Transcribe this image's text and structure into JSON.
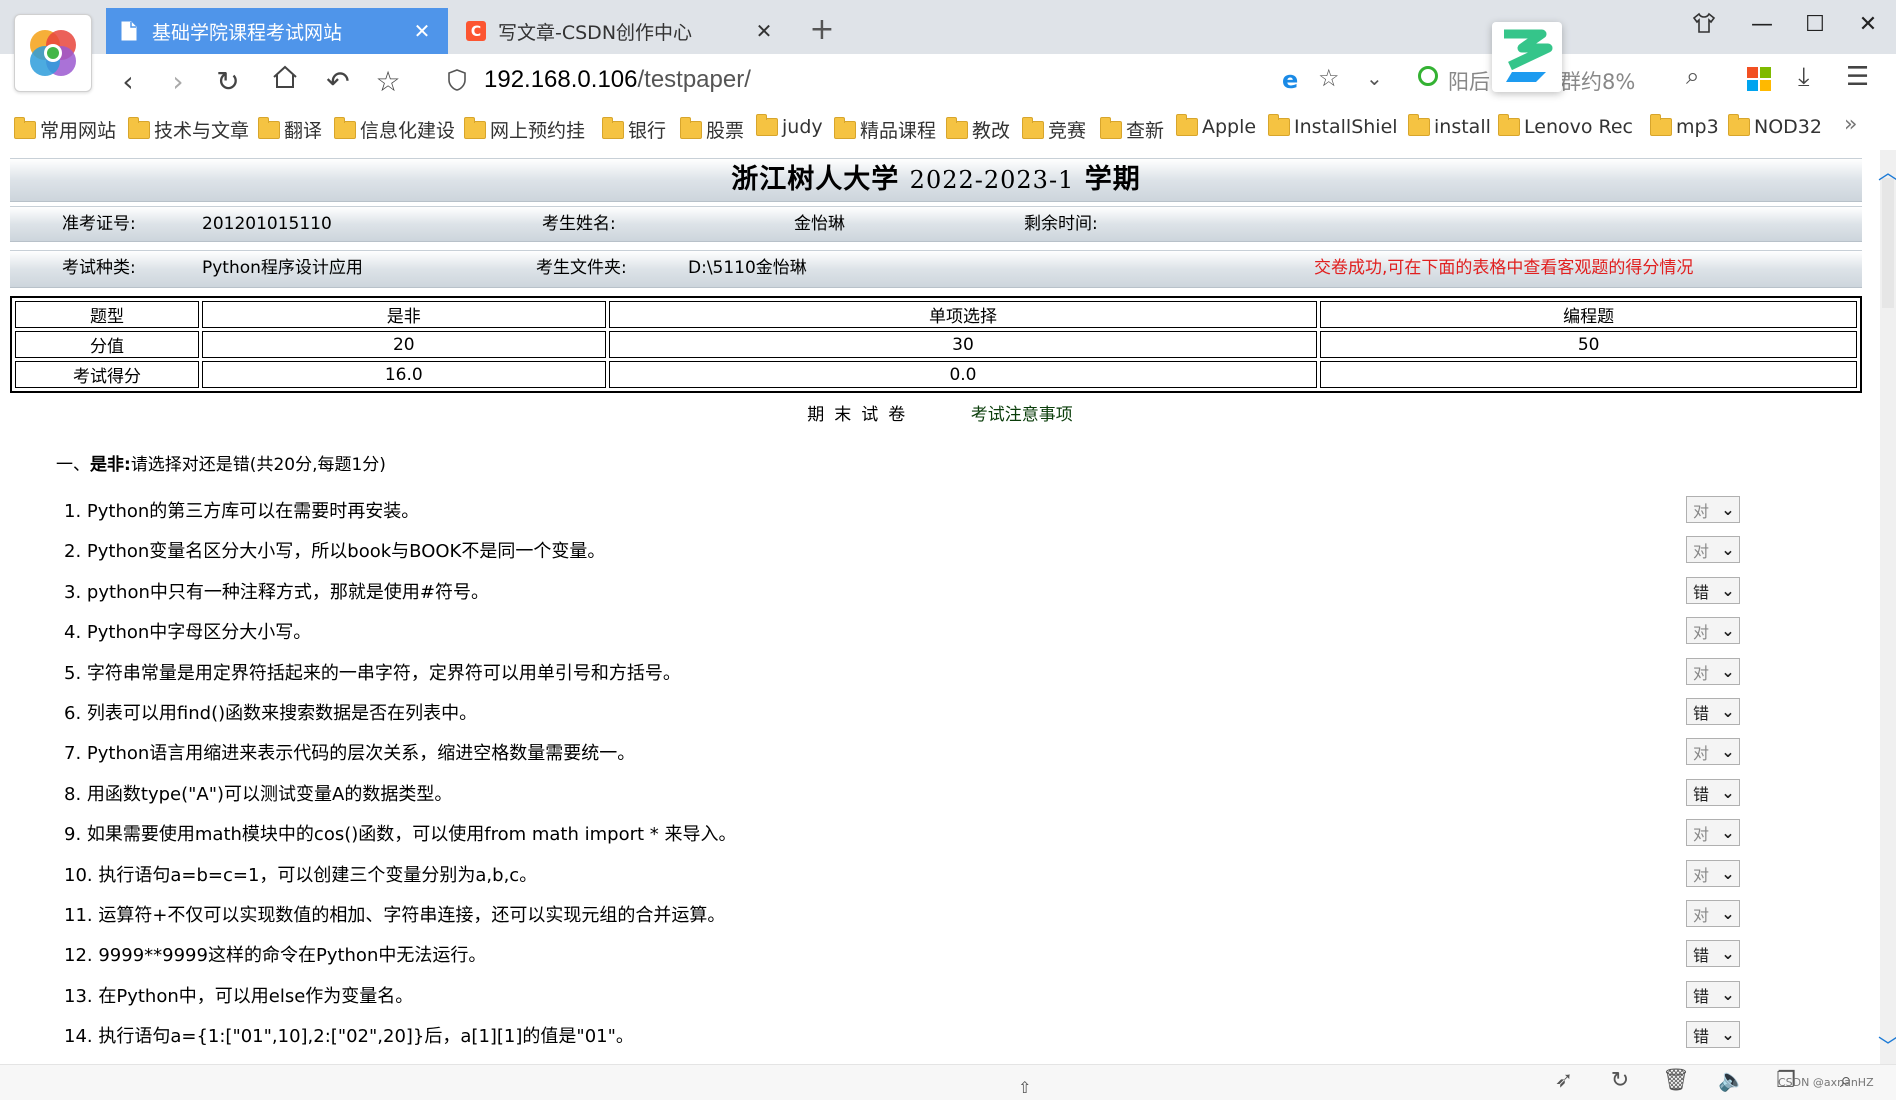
{
  "browser": {
    "tabs": [
      {
        "label": "基础学院课程考试网站",
        "active": true,
        "icon": "page-icon"
      },
      {
        "label": "写文章-CSDN创作中心",
        "active": false,
        "icon": "csdn-icon"
      }
    ],
    "new_tab_glyph": "+",
    "url_host": "192.168.0.106",
    "url_path": "/testpaper/",
    "search_text_left": "阳后",
    "search_text_right": "群约8%",
    "window_controls": [
      "shirt-icon",
      "minimize-icon",
      "maximize-icon",
      "close-icon"
    ],
    "bookmarks": [
      "常用网站",
      "技术与文章",
      "翻译",
      "信息化建设",
      "网上预约挂",
      "银行",
      "股票",
      "judy",
      "精品课程",
      "教改",
      "竞赛",
      "查新",
      "Apple",
      "InstallShiel",
      "install",
      "Lenovo Rec",
      "mp3",
      "NOD32"
    ],
    "bookmarks_more": "»"
  },
  "exam": {
    "title_school": "浙江树人大学",
    "title_term": "2022-2023-1",
    "title_suffix": "学期",
    "ticket_label": "准考证号:",
    "ticket_value": "201201015110",
    "name_label": "考生姓名:",
    "name_value": "金怡琳",
    "time_label": "剩余时间:",
    "type_label": "考试种类:",
    "type_value": "Python程序设计应用",
    "folder_label": "考生文件夹:",
    "folder_value": "D:\\5110金怡琳",
    "status_message": "交卷成功,可在下面的表格中查看客观题的得分情况",
    "status_color": "#e02020"
  },
  "score_table": {
    "row_labels": [
      "题型",
      "分值",
      "考试得分"
    ],
    "columns": [
      "是非",
      "单项选择",
      "编程题"
    ],
    "points": [
      "20",
      "30",
      "50"
    ],
    "scores": [
      "16.0",
      "0.0",
      ""
    ]
  },
  "links": {
    "paper": "期末试卷",
    "notice": "考试注意事项"
  },
  "section": {
    "number": "一、",
    "name": "是非:",
    "desc": "请选择对还是错(共20分,每题1分)"
  },
  "questions": [
    {
      "text": "1. Python的第三方库可以在需要时再安装。",
      "answer": "对"
    },
    {
      "text": "2. Python变量名区分大小写，所以book与BOOK不是同一个变量。",
      "answer": "对"
    },
    {
      "text": "3. python中只有一种注释方式，那就是使用#符号。",
      "answer": "错"
    },
    {
      "text": "4. Python中字母区分大小写。",
      "answer": "对"
    },
    {
      "text": "5. 字符串常量是用定界符括起来的一串字符，定界符可以用单引号和方括号。",
      "answer": "对"
    },
    {
      "text": "6. 列表可以用find()函数来搜索数据是否在列表中。",
      "answer": "错"
    },
    {
      "text": "7. Python语言用缩进来表示代码的层次关系，缩进空格数量需要统一。",
      "answer": "对"
    },
    {
      "text": "8. 用函数type(\"A\")可以测试变量A的数据类型。",
      "answer": "错"
    },
    {
      "text": "9. 如果需要使用math模块中的cos()函数，可以使用from math import * 来导入。",
      "answer": "对"
    },
    {
      "text": "10. 执行语句a=b=c=1，可以创建三个变量分别为a,b,c。",
      "answer": "对"
    },
    {
      "text": "11. 运算符+不仅可以实现数值的相加、字符串连接，还可以实现元组的合并运算。",
      "answer": "对"
    },
    {
      "text": "12. 9999**9999这样的命令在Python中无法运行。",
      "answer": "错"
    },
    {
      "text": "13. 在Python中，可以用else作为变量名。",
      "answer": "错"
    },
    {
      "text": "14. 执行语句a={1:[\"01\",10],2:[\"02\",20]}后，a[1][1]的值是\"01\"。",
      "answer": "错"
    }
  ],
  "statusbar": {
    "icons": [
      "rocket-icon",
      "refresh-icon",
      "trash-icon",
      "speaker-icon",
      "window-icon",
      "search-icon"
    ],
    "watermark": "CSDN @axnanHZ"
  }
}
